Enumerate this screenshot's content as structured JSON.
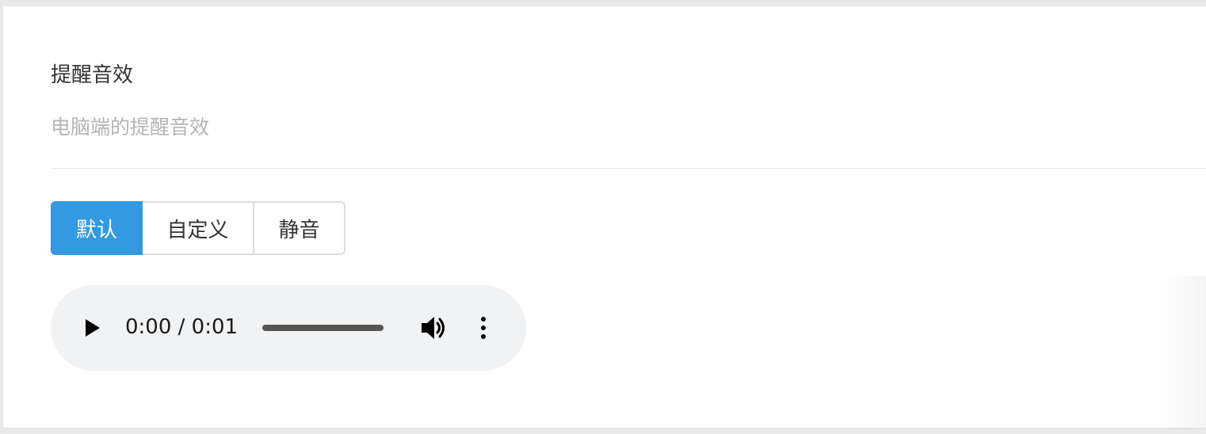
{
  "settings": {
    "title": "提醒音效",
    "description": "电脑端的提醒音效"
  },
  "sound_mode": {
    "options": [
      {
        "label": "默认",
        "selected": true
      },
      {
        "label": "自定义",
        "selected": false
      },
      {
        "label": "静音",
        "selected": false
      }
    ]
  },
  "audio_player": {
    "current_time": "0:00",
    "separator": "/",
    "duration": "0:01",
    "time_display": "0:00 / 0:01",
    "progress_fraction": 0,
    "icons": {
      "play": "play-icon",
      "volume": "volume-icon",
      "more": "more-vertical-icon"
    }
  },
  "colors": {
    "accent": "#3399e0",
    "player_bg": "#f1f2f4",
    "muted_text": "#b4b4b4",
    "text": "#333333"
  }
}
